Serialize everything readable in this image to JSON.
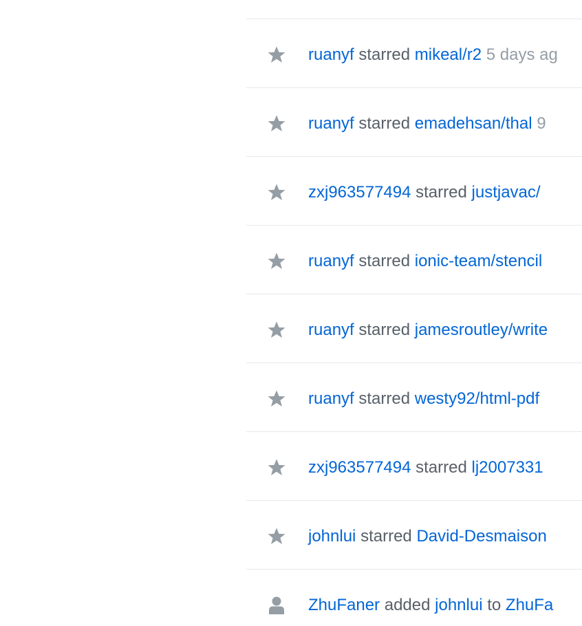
{
  "colors": {
    "link": "#0366d6",
    "text": "#586069",
    "muted": "#959da5",
    "icon": "#959da5",
    "divider": "#e6e8eb"
  },
  "feed": {
    "events": [
      {
        "icon": "star-icon",
        "actor": "ruanyf",
        "verb": "starred",
        "target": "mikeal/r2",
        "time": "5 days ag"
      },
      {
        "icon": "star-icon",
        "actor": "ruanyf",
        "verb": "starred",
        "target": "emadehsan/thal",
        "time": "9"
      },
      {
        "icon": "star-icon",
        "actor": "zxj963577494",
        "verb": "starred",
        "target": "justjavac/"
      },
      {
        "icon": "star-icon",
        "actor": "ruanyf",
        "verb": "starred",
        "target": "ionic-team/stencil"
      },
      {
        "icon": "star-icon",
        "actor": "ruanyf",
        "verb": "starred",
        "target": "jamesroutley/write"
      },
      {
        "icon": "star-icon",
        "actor": "ruanyf",
        "verb": "starred",
        "target": "westy92/html-pdf"
      },
      {
        "icon": "star-icon",
        "actor": "zxj963577494",
        "verb": "starred",
        "target": "lj2007331"
      },
      {
        "icon": "star-icon",
        "actor": "johnlui",
        "verb": "starred",
        "target": "David-Desmaison"
      },
      {
        "icon": "person-icon",
        "actor": "ZhuFaner",
        "verb": "added",
        "target": "johnlui",
        "connector": "to",
        "target2": "ZhuFa"
      }
    ]
  }
}
